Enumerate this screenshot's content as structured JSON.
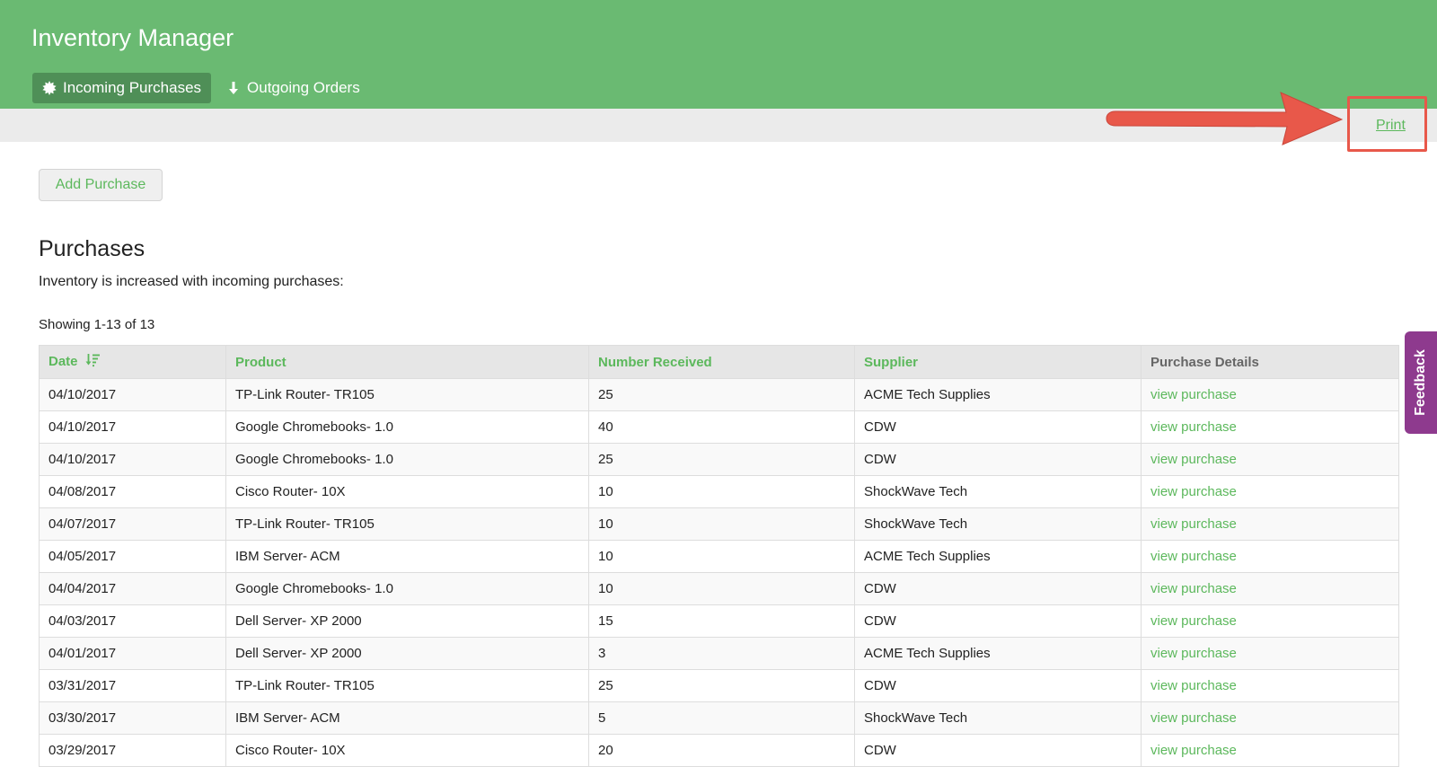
{
  "app": {
    "title": "Inventory Manager"
  },
  "nav": {
    "tabs": [
      {
        "label": "Incoming Purchases",
        "icon": "starburst-icon",
        "active": true
      },
      {
        "label": "Outgoing Orders",
        "icon": "arrow-down-icon",
        "active": false
      }
    ]
  },
  "toolbar": {
    "print_label": "Print"
  },
  "actions": {
    "add_purchase_label": "Add Purchase"
  },
  "section": {
    "title": "Purchases",
    "description": "Inventory is increased with incoming purchases:",
    "showing": "Showing 1-13 of 13"
  },
  "table": {
    "headers": {
      "date": "Date",
      "product": "Product",
      "number_received": "Number Received",
      "supplier": "Supplier",
      "purchase_details": "Purchase Details"
    },
    "sort_icon": "sort-descending-icon",
    "link_label": "view purchase",
    "rows": [
      {
        "date": "04/10/2017",
        "product": "TP-Link Router- TR105",
        "number": "25",
        "supplier": "ACME Tech Supplies"
      },
      {
        "date": "04/10/2017",
        "product": "Google Chromebooks- 1.0",
        "number": "40",
        "supplier": "CDW"
      },
      {
        "date": "04/10/2017",
        "product": "Google Chromebooks- 1.0",
        "number": "25",
        "supplier": "CDW"
      },
      {
        "date": "04/08/2017",
        "product": "Cisco Router- 10X",
        "number": "10",
        "supplier": "ShockWave Tech"
      },
      {
        "date": "04/07/2017",
        "product": "TP-Link Router- TR105",
        "number": "10",
        "supplier": "ShockWave Tech"
      },
      {
        "date": "04/05/2017",
        "product": "IBM Server- ACM",
        "number": "10",
        "supplier": "ACME Tech Supplies"
      },
      {
        "date": "04/04/2017",
        "product": "Google Chromebooks- 1.0",
        "number": "10",
        "supplier": "CDW"
      },
      {
        "date": "04/03/2017",
        "product": "Dell Server- XP 2000",
        "number": "15",
        "supplier": "CDW"
      },
      {
        "date": "04/01/2017",
        "product": "Dell Server- XP 2000",
        "number": "3",
        "supplier": "ACME Tech Supplies"
      },
      {
        "date": "03/31/2017",
        "product": "TP-Link Router- TR105",
        "number": "25",
        "supplier": "CDW"
      },
      {
        "date": "03/30/2017",
        "product": "IBM Server- ACM",
        "number": "5",
        "supplier": "ShockWave Tech"
      },
      {
        "date": "03/29/2017",
        "product": "Cisco Router- 10X",
        "number": "20",
        "supplier": "CDW"
      }
    ]
  },
  "feedback": {
    "label": "Feedback"
  },
  "colors": {
    "header_green": "#6aba72",
    "active_tab": "#4f8f57",
    "link_green": "#5cb85c",
    "annotation_red": "#e8584a",
    "feedback_purple": "#8e3a8e"
  }
}
